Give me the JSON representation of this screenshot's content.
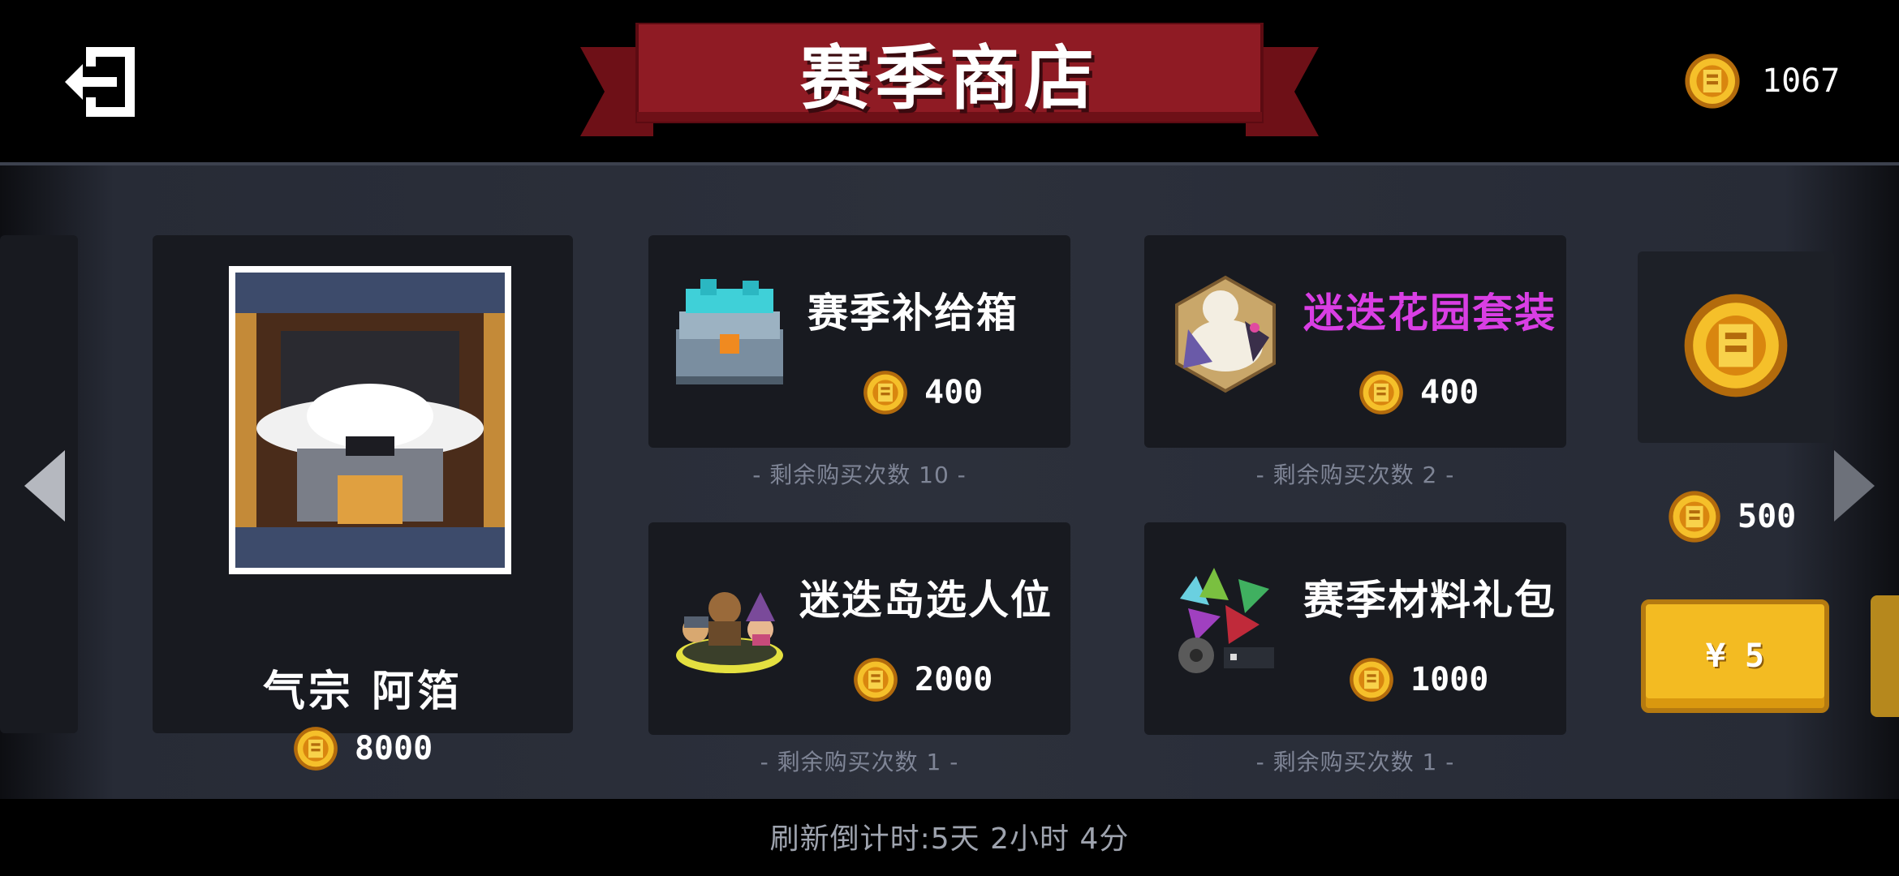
{
  "header": {
    "title": "赛季商店",
    "coins": "1067"
  },
  "hero": {
    "name": "气宗 阿箔",
    "price": "8000"
  },
  "items": [
    {
      "title": "赛季补给箱",
      "price": "400",
      "remaining": "- 剩余购买次数 10 -",
      "rare": false
    },
    {
      "title": "迷迭花园套装",
      "price": "400",
      "remaining": "- 剩余购买次数 2 -",
      "rare": true
    },
    {
      "title": "迷迭岛选人位",
      "price": "2000",
      "remaining": "- 剩余购买次数 1 -",
      "rare": false
    },
    {
      "title": "赛季材料礼包",
      "price": "1000",
      "remaining": "- 剩余购买次数 1 -",
      "rare": false
    }
  ],
  "coin_pack": {
    "coins": "500",
    "cost": "¥ 5"
  },
  "footer": {
    "refresh": "刷新倒计时:5天 2小时 4分"
  },
  "colors": {
    "banner_red": "#8a1a22",
    "coin_gold": "#f3bb22",
    "rare_purple": "#d93ee4"
  },
  "icons": [
    "exit-icon",
    "coin-icon",
    "chest-icon",
    "outfit-icon",
    "characters-icon",
    "materials-icon",
    "arrow-left-icon",
    "arrow-right-icon"
  ]
}
